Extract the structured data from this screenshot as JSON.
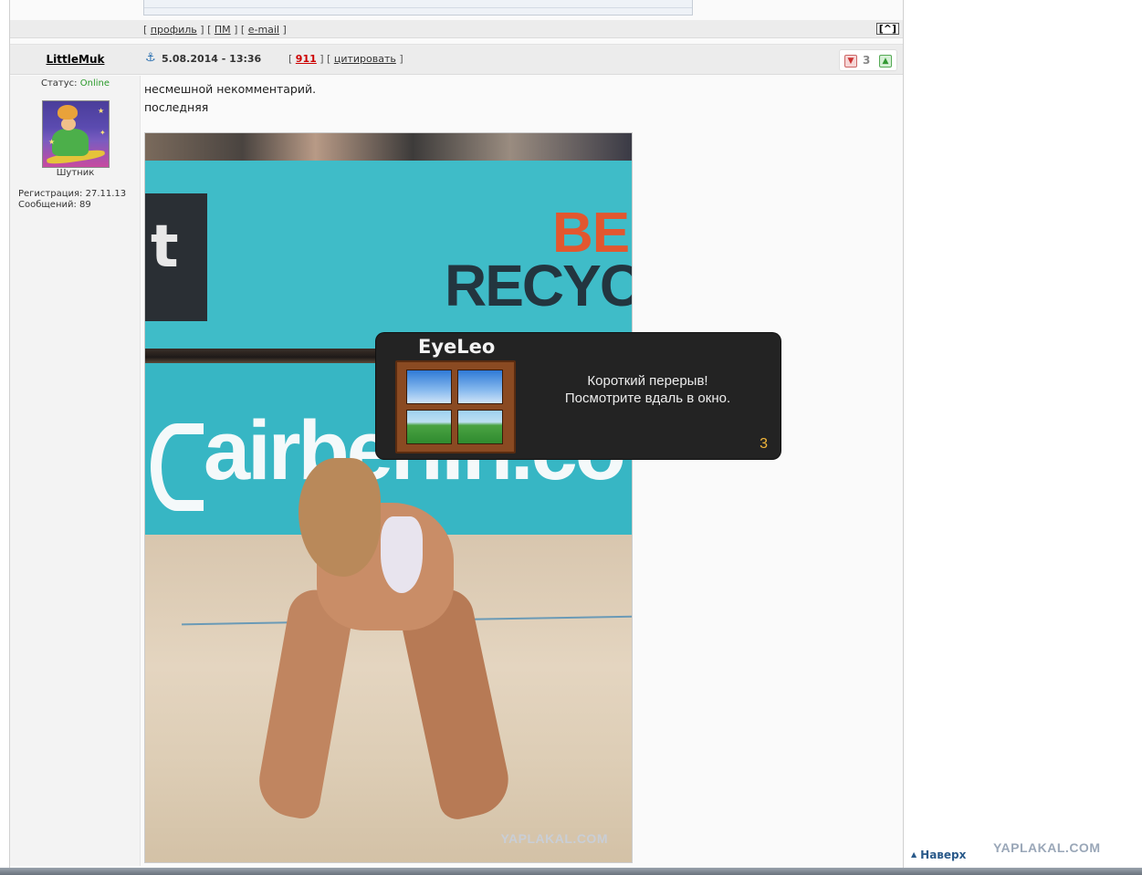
{
  "prev_post": {
    "links": {
      "open": "[ ",
      "profile": "профиль",
      "sep1": " ] [ ",
      "pm": "ПМ",
      "sep2": " ] [ ",
      "email": "e-mail",
      "close": " ]"
    },
    "up_button": "[^]"
  },
  "post": {
    "author": "LittleMuk",
    "date": "5.08.2014 - 13:36",
    "number": {
      "open": "[ ",
      "value": "911",
      "sep": " ] [ ",
      "quote": "цитировать",
      "close": " ]"
    },
    "rating": {
      "value": "3",
      "down_icon": "thumb-down-icon",
      "up_icon": "thumb-up-icon"
    },
    "text_lines": [
      "несмешной некомментарий.",
      "последняя"
    ],
    "image_watermark": "YAPLAKAL.COM"
  },
  "user": {
    "status_label": "Статус: ",
    "status_value": "Online",
    "rank": "Шутник",
    "reg_label": "Регистрация: 27.11.13",
    "posts_label": "Сообщений: 89"
  },
  "photo_text": {
    "board_left": "t",
    "board_red": "BE",
    "board_dark": "RECYC",
    "board_air": "airberlin.co"
  },
  "eyeleo": {
    "title": "EyeLeo",
    "message_line1": "Короткий перерыв!",
    "message_line2": "Посмотрите вдаль в окно.",
    "countdown": "3"
  },
  "footer": {
    "to_top": "Наверх",
    "site_watermark": "YAPLAKAL.COM"
  },
  "colors": {
    "online": "#2a9a2a",
    "post_number": "#cc0000",
    "countdown": "#f0b43a",
    "popup_bg": "#232323"
  }
}
